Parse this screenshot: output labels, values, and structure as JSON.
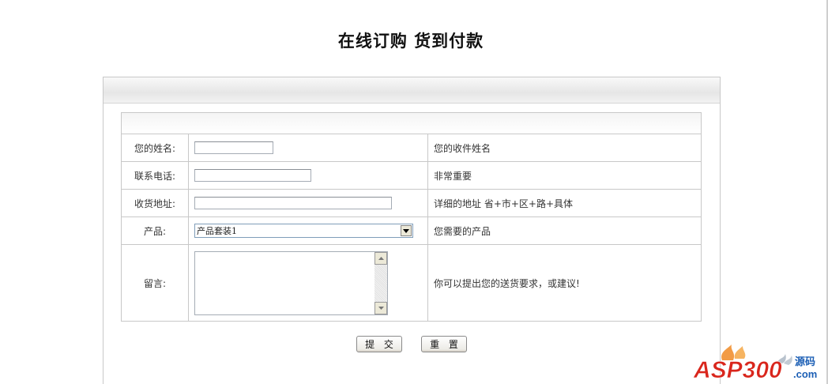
{
  "page": {
    "title": "在线订购  货到付款"
  },
  "form": {
    "rows": [
      {
        "label": "您的姓名:",
        "note": "您的收件姓名"
      },
      {
        "label": "联系电话:",
        "note": "非常重要"
      },
      {
        "label": "收货地址:",
        "note": "详细的地址 省+市+区+路+具体"
      },
      {
        "label": "产品:",
        "note": "您需要的产品"
      },
      {
        "label": "留言:",
        "note": "你可以提出您的送货要求，或建议!"
      }
    ],
    "name_value": "",
    "phone_value": "",
    "address_value": "",
    "product_selected": "产品套装1",
    "message_value": ""
  },
  "buttons": {
    "submit": "提 交",
    "reset": "重 置"
  },
  "logo": {
    "main": "ASP300",
    "tag": "源码",
    "sub": ".com"
  },
  "colors": {
    "logo_red": "#d9261c",
    "logo_blue": "#1c5fb5"
  }
}
